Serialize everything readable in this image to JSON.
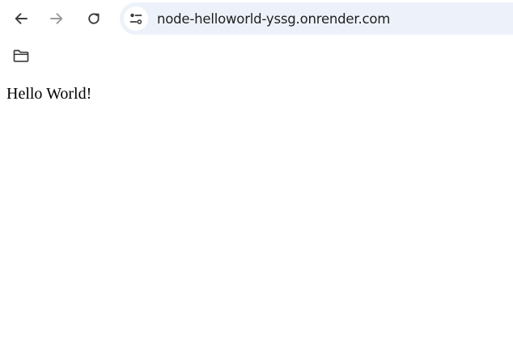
{
  "toolbar": {
    "back_icon": "arrow-left-icon",
    "forward_icon": "arrow-right-icon",
    "reload_icon": "reload-icon",
    "omnibox": {
      "site_info_icon": "tune-icon",
      "url": "node-helloworld-yssg.onrender.com",
      "background": "#edf2fa"
    }
  },
  "bookmarks_bar": {
    "folder_icon": "folder-icon"
  },
  "page": {
    "body_text": "Hello World!"
  }
}
